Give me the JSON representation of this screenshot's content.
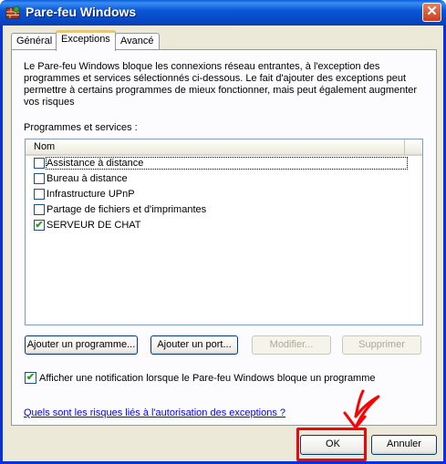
{
  "window": {
    "title": "Pare-feu Windows",
    "close_glyph": "✕"
  },
  "tabs": [
    {
      "label": "Général"
    },
    {
      "label": "Exceptions"
    },
    {
      "label": "Avancé"
    }
  ],
  "description": "Le Pare-feu Windows bloque les connexions réseau entrantes, à l'exception des programmes et services sélectionnés ci-dessous. Le fait d'ajouter des exceptions peut permettre à certains programmes de mieux fonctionner, mais peut également augmenter vos risques",
  "programs": {
    "label": "Programmes et services :",
    "column_header": "Nom",
    "items": [
      {
        "label": "Assistance à distance",
        "checked": false
      },
      {
        "label": "Bureau à distance",
        "checked": false
      },
      {
        "label": "Infrastructure UPnP",
        "checked": false
      },
      {
        "label": "Partage de fichiers et d'imprimantes",
        "checked": false
      },
      {
        "label": "SERVEUR DE CHAT",
        "checked": true
      }
    ]
  },
  "buttons": {
    "add_program": "Ajouter un programme...",
    "add_port": "Ajouter un port...",
    "modify": "Modifier...",
    "delete": "Supprimer",
    "ok": "OK",
    "cancel": "Annuler"
  },
  "notify": {
    "label": "Afficher une notification lorsque le Pare-feu Windows bloque un programme",
    "checked": true
  },
  "help_link": "Quels sont les risques liés à l'autorisation des exceptions ?",
  "check_glyph": "✔",
  "colors": {
    "titlebar": "#0a57d6",
    "annotation": "#ff0000",
    "tab_highlight": "#ffc83c"
  }
}
